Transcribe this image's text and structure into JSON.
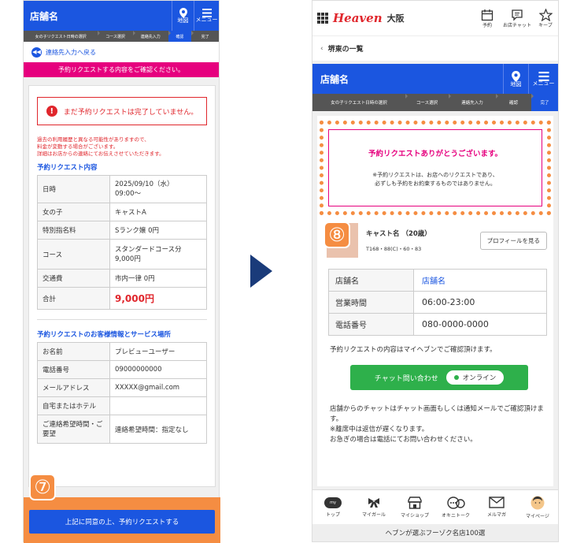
{
  "left": {
    "header": {
      "title": "店舗名",
      "map_label": "地図",
      "menu_label": "メニュー"
    },
    "steps": [
      "女の子リクエスト日時の選択",
      "コース選択",
      "連絡先入力",
      "確認",
      "完了"
    ],
    "back_link": "連絡先入力へ戻る",
    "banner": "予約リクエストする内容をご確認ください。",
    "alert": "まだ予約リクエストは完了していません。",
    "notice": [
      "過去の利用履歴と異なる可能性がありますので、",
      "料金が変動する場合がございます。",
      "詳細はお店からの連絡にてお伝えさせていただきます。"
    ],
    "section1_title": "予約リクエスト内容",
    "rows1": [
      {
        "label": "日時",
        "value": "2025/09/10（水）09:00〜"
      },
      {
        "label": "女の子",
        "value": "キャストA"
      },
      {
        "label": "特別指名料",
        "value": "Sランク嬢 0円"
      },
      {
        "label": "コース",
        "value": "スタンダードコース分 9,000円"
      },
      {
        "label": "交通費",
        "value": "市内一律 0円"
      },
      {
        "label": "合計",
        "value": "9,000円"
      }
    ],
    "section2_title": "予約リクエストのお客様情報とサービス場所",
    "rows2": [
      {
        "label": "お名前",
        "value": "プレビューユーザー"
      },
      {
        "label": "電話番号",
        "value": "09000000000"
      },
      {
        "label": "メールアドレス",
        "value": "XXXXX@gmail.com"
      },
      {
        "label": "自宅またはホテル",
        "value": ""
      },
      {
        "label": "ご連絡希望時間・ご要望",
        "value": "連絡希望時間：指定なし"
      }
    ],
    "step_num": "⑦",
    "submit_label": "上記に同意の上、予約リクエストする"
  },
  "right": {
    "top": {
      "logo": "Heaven",
      "region": "大阪",
      "icon1": "予約",
      "icon2": "お店チャット",
      "icon3": "キープ"
    },
    "breadcrumb": "堺東の一覧",
    "header": {
      "title": "店舗名",
      "map_label": "地図",
      "menu_label": "メニュー"
    },
    "steps": [
      "女の子リクエスト日時の選択",
      "コース選択",
      "連絡先入力",
      "確認",
      "完了"
    ],
    "thanks_title": "予約リクエストありがとうございます。",
    "thanks_note1": "※予約リクエストは、お店へのリクエストであり、",
    "thanks_note2": "必ずしも予約をお約束するものではありません。",
    "step_num": "⑧",
    "cast": {
      "name": "キャスト名 （20歳）",
      "specs": "T168・88(C)・60・83",
      "profile_btn": "プロフィールを見る"
    },
    "shop_rows": [
      {
        "label": "店舗名",
        "value": "店舗名"
      },
      {
        "label": "営業時間",
        "value": "06:00-23:00"
      },
      {
        "label": "電話番号",
        "value": "080-0000-0000"
      }
    ],
    "confirm_text": "予約リクエストの内容はマイヘブンでご確認頂けます。",
    "chat_btn": "チャット問い合わせ",
    "online": "オンライン",
    "info1": "店舗からのチャットはチャット画面もしくは通知メールでご確認頂けます。",
    "info2": "※離席中は返信が遅くなります。",
    "info3": "お急ぎの場合は電話にてお問い合わせください。",
    "nav": [
      "トップ",
      "マイガール",
      "マイショップ",
      "オキニトーク",
      "メルマガ",
      "マイページ"
    ],
    "footer": "ヘブンが選ぶフーゾク名店100選"
  },
  "colors": {
    "brand_blue": "#1b56e0",
    "pink": "#e6007e",
    "red": "#e0262c",
    "green": "#2eb04b",
    "orange": "#f58d42",
    "navy": "#1a3b7a"
  }
}
